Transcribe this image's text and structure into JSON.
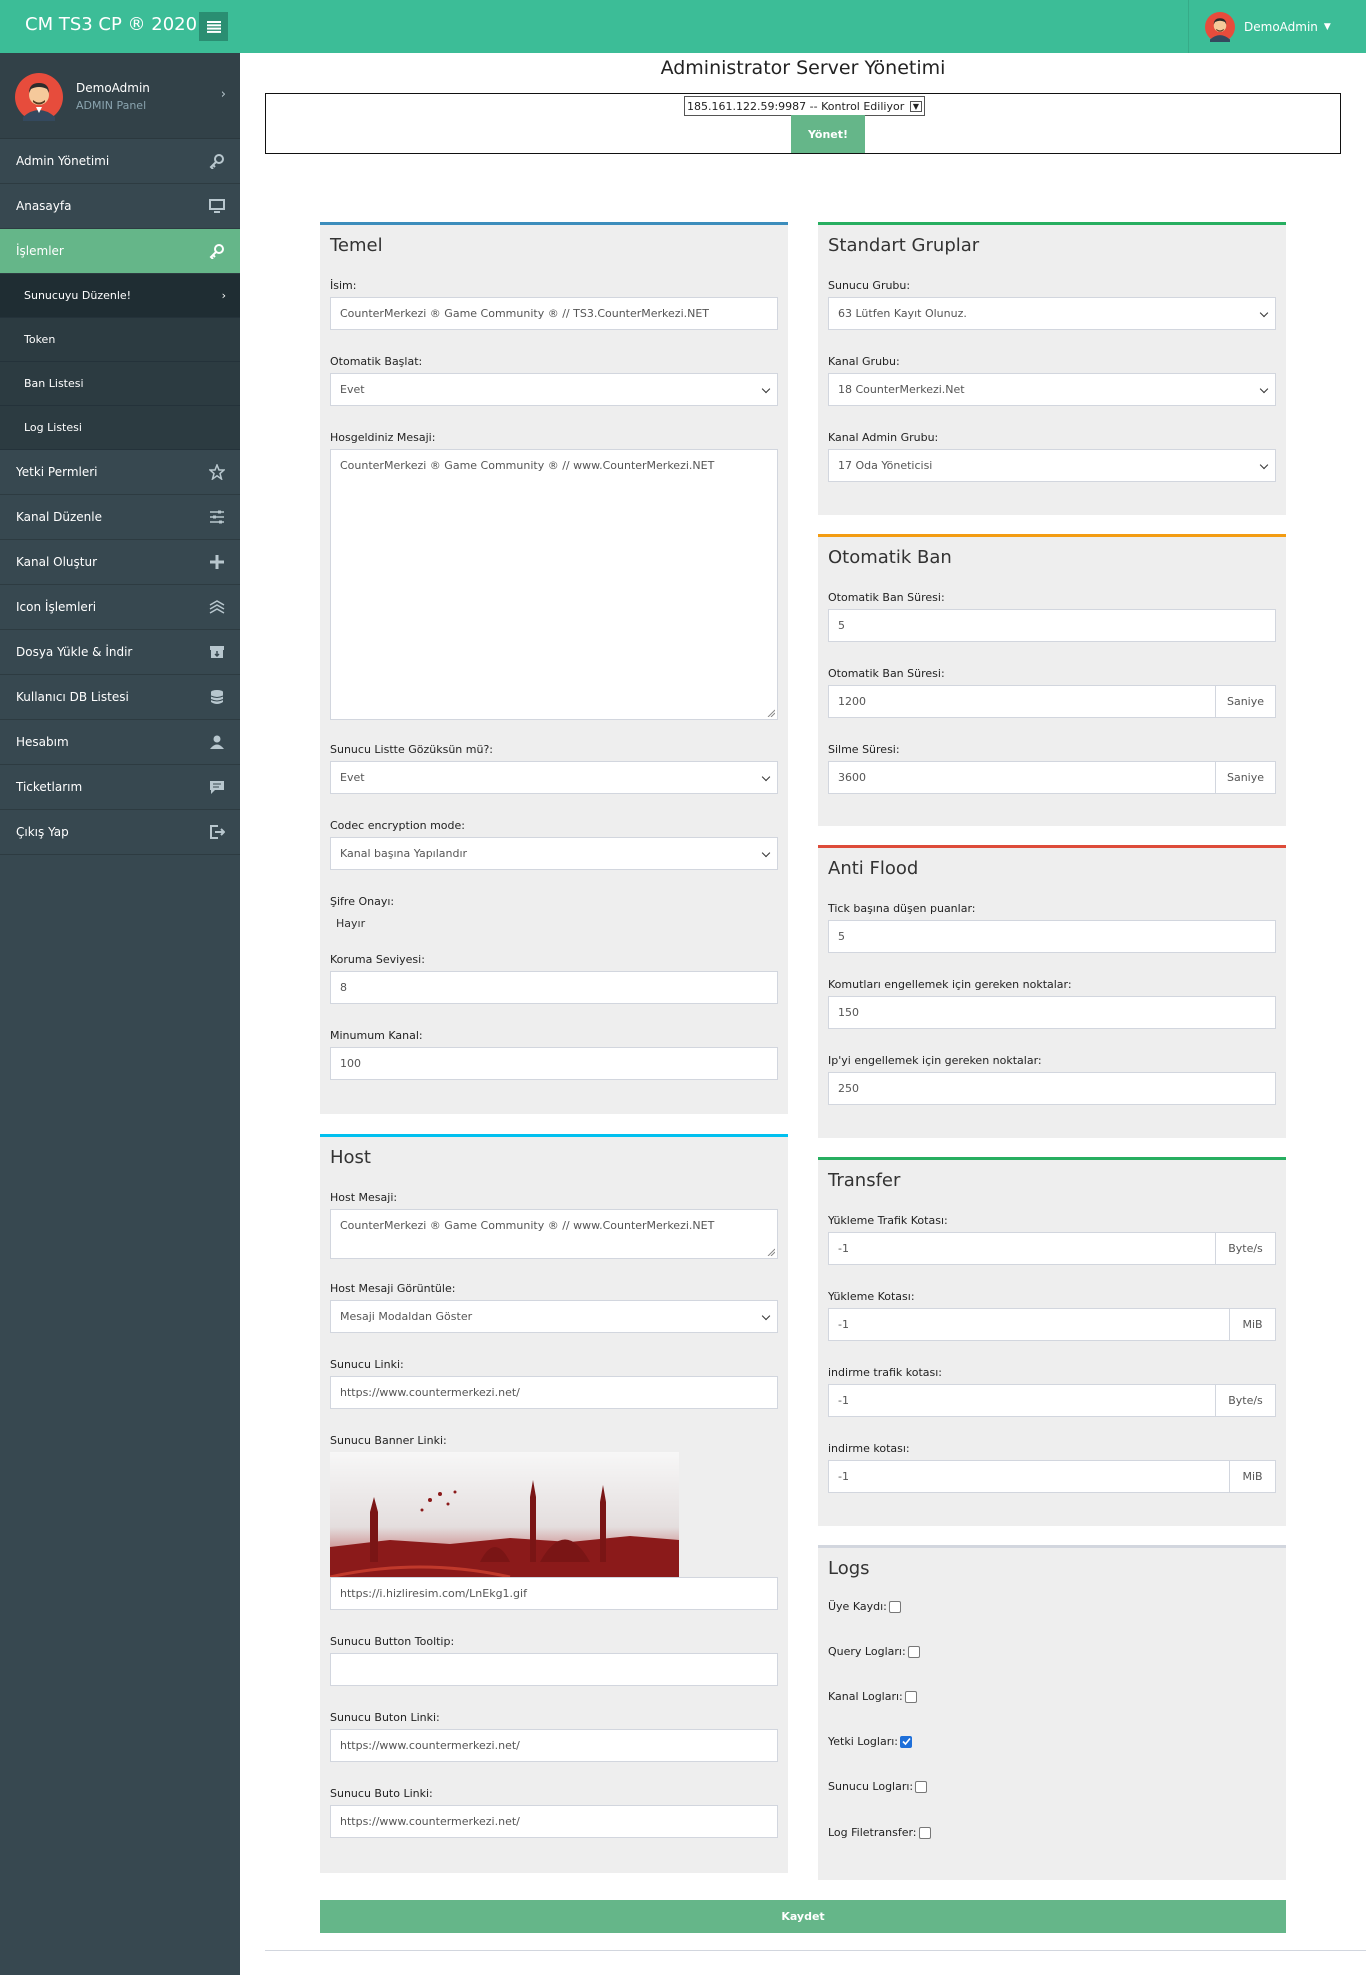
{
  "brand": "CM TS3 CP ® 2020",
  "topbar": {
    "user": "DemoAdmin"
  },
  "sidebar": {
    "user_name": "DemoAdmin",
    "user_role": "ADMIN Panel",
    "items": [
      {
        "label": "Admin Yönetimi",
        "icon": "key-icon"
      },
      {
        "label": "Anasayfa",
        "icon": "monitor-icon"
      },
      {
        "label": "İşlemler",
        "icon": "key-icon"
      },
      {
        "label": "Yetki Permleri",
        "icon": "star-icon"
      },
      {
        "label": "Kanal Düzenle",
        "icon": "sliders-icon"
      },
      {
        "label": "Kanal Oluştur",
        "icon": "plus-icon"
      },
      {
        "label": "Icon İşlemleri",
        "icon": "layers-icon"
      },
      {
        "label": "Dosya Yükle & İndir",
        "icon": "box-icon"
      },
      {
        "label": "Kullanıcı DB Listesi",
        "icon": "database-icon"
      },
      {
        "label": "Hesabım",
        "icon": "user-icon"
      },
      {
        "label": "Ticketlarım",
        "icon": "comment-icon"
      },
      {
        "label": "Çıkış Yap",
        "icon": "logout-icon"
      }
    ],
    "subitems": [
      "Sunucuyu Düzenle!",
      "Token",
      "Ban Listesi",
      "Log Listesi"
    ]
  },
  "page_title": "Administrator Server Yönetimi",
  "server_select": {
    "value": "185.161.122.59:9987 -- Kontrol Ediliyor",
    "button": "Yönet!"
  },
  "temel": {
    "title": "Temel",
    "isim_label": "İsim:",
    "isim_value": "CounterMerkezi ® Game Community ® // TS3.CounterMerkezi.NET",
    "oto_baslat_label": "Otomatik Başlat:",
    "oto_baslat_value": "Evet",
    "hosgeldin_label": "Hosgeldiniz Mesaji:",
    "hosgeldin_value": "CounterMerkezi ® Game Community ® // www.CounterMerkezi.NET",
    "listte_label": "Sunucu Listte Gözüksün mü?:",
    "listte_value": "Evet",
    "codec_label": "Codec encryption mode:",
    "codec_value": "Kanal başına Yapılandır",
    "sifre_label": "Şifre Onayı:",
    "sifre_value": "Hayır",
    "koruma_label": "Koruma Seviyesi:",
    "koruma_value": "8",
    "min_kanal_label": "Minumum Kanal:",
    "min_kanal_value": "100"
  },
  "host": {
    "title": "Host",
    "mesaj_label": "Host Mesaji:",
    "mesaj_value": "CounterMerkezi ® Game Community ® // www.CounterMerkezi.NET",
    "goruntule_label": "Host Mesaji Görüntüle:",
    "goruntule_value": "Mesaji Modaldan Göster",
    "link_label": "Sunucu Linki:",
    "link_value": "https://www.countermerkezi.net/",
    "banner_label": "Sunucu Banner Linki:",
    "banner_value": "https://i.hizliresim.com/LnEkg1.gif",
    "tooltip_label": "Sunucu Button Tooltip:",
    "tooltip_value": "",
    "buton_link_label": "Sunucu Buton Linki:",
    "buton_link_value": "https://www.countermerkezi.net/",
    "buto_link_label": "Sunucu Buto Linki:",
    "buto_link_value": "https://www.countermerkezi.net/"
  },
  "gruplar": {
    "title": "Standart Gruplar",
    "sunucu_label": "Sunucu Grubu:",
    "sunucu_value": "63 Lütfen Kayıt Olunuz.",
    "kanal_label": "Kanal Grubu:",
    "kanal_value": "18 CounterMerkezi.Net",
    "kanal_admin_label": "Kanal Admin Grubu:",
    "kanal_admin_value": "17 Oda Yöneticisi"
  },
  "otoban": {
    "title": "Otomatik Ban",
    "sure1_label": "Otomatik Ban Süresi:",
    "sure1_value": "5",
    "sure2_label": "Otomatik Ban Süresi:",
    "sure2_value": "1200",
    "sure2_unit": "Saniye",
    "silme_label": "Silme Süresi:",
    "silme_value": "3600",
    "silme_unit": "Saniye"
  },
  "antiflood": {
    "title": "Anti Flood",
    "tick_label": "Tick başına düşen puanlar:",
    "tick_value": "5",
    "komut_label": "Komutları engellemek için gereken noktalar:",
    "komut_value": "150",
    "ip_label": "Ip'yi engellemek için gereken noktalar:",
    "ip_value": "250"
  },
  "transfer": {
    "title": "Transfer",
    "y_trafik_label": "Yükleme Trafik Kotası:",
    "y_trafik_value": "-1",
    "y_trafik_unit": "Byte/s",
    "y_kota_label": "Yükleme Kotası:",
    "y_kota_value": "-1",
    "y_kota_unit": "MiB",
    "i_trafik_label": "indirme trafik kotası:",
    "i_trafik_value": "-1",
    "i_trafik_unit": "Byte/s",
    "i_kota_label": "indirme kotası:",
    "i_kota_value": "-1",
    "i_kota_unit": "MiB"
  },
  "logs": {
    "title": "Logs",
    "items": [
      {
        "label": "Üye Kaydı:",
        "checked": false
      },
      {
        "label": "Query Logları:",
        "checked": false
      },
      {
        "label": "Kanal Logları:",
        "checked": false
      },
      {
        "label": "Yetki Logları:",
        "checked": true
      },
      {
        "label": "Sunucu Logları:",
        "checked": false
      },
      {
        "label": "Log Filetransfer:",
        "checked": false
      }
    ]
  },
  "save_button": "Kaydet",
  "colors": {
    "accent": "#3cbd97",
    "green_button": "#65b689",
    "sidebar": "#374850"
  }
}
